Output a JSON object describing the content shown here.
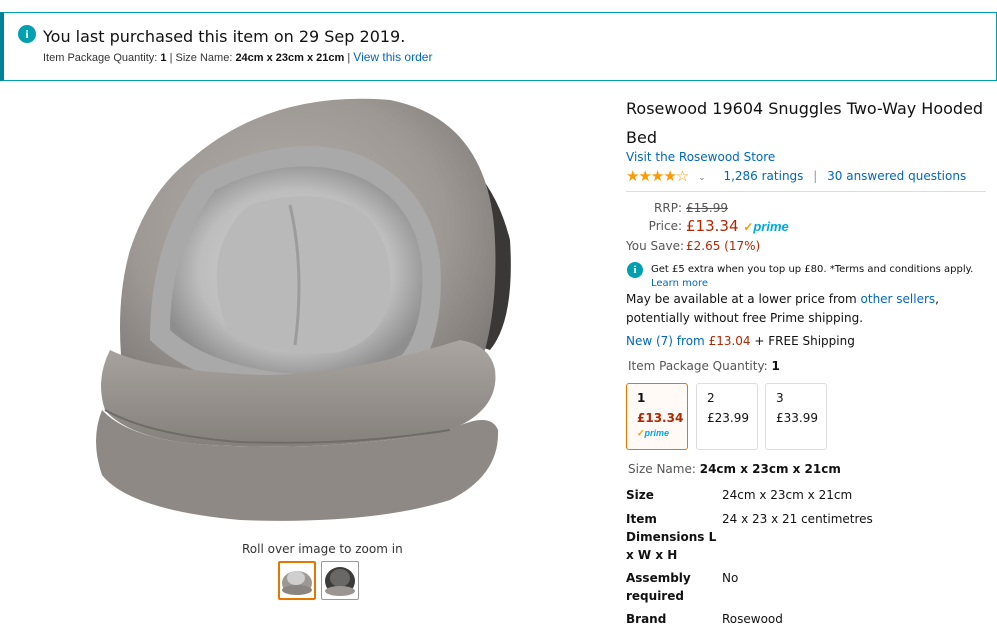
{
  "banner": {
    "info_icon": "info-icon",
    "title": "You last purchased this item on 29 Sep 2019.",
    "qty_label": "Item Package Quantity:",
    "qty_value": "1",
    "size_label": "Size Name:",
    "size_value": "24cm x 23cm x 21cm",
    "view_order": "View this order"
  },
  "gallery": {
    "zoom_hint": "Roll over image to zoom in",
    "thumbnails": [
      "thumbnail-front",
      "thumbnail-back"
    ]
  },
  "product": {
    "title": "Rosewood 19604 Snuggles Two-Way Hooded Bed",
    "store_link": "Visit the Rosewood Store",
    "stars": "★★★★☆",
    "rating_value": 4.0,
    "ratings_count": "1,286 ratings",
    "answered_questions": "30 answered questions",
    "rrp_label": "RRP:",
    "rrp_value": "£15.99",
    "price_label": "Price:",
    "price_value": "£13.34",
    "prime_check": "✓",
    "prime_label": "prime",
    "save_label": "You Save:",
    "save_value": "£2.65 (17%)",
    "topup_text": "Get £5 extra when you top up £80. *Terms and conditions apply.",
    "topup_link": "Learn more",
    "lower_price_text_1": "May be available at a lower price from",
    "lower_price_link": "other sellers",
    "lower_price_text_2": ", potentially without free Prime shipping.",
    "new_link": "New (7) from",
    "new_price": "£13.04",
    "new_shipping": "+ FREE Shipping",
    "qty_label": "Item Package Quantity:",
    "qty_selected": "1",
    "qty_options": [
      {
        "num": "1",
        "price": "£13.34",
        "prime": "prime"
      },
      {
        "num": "2",
        "price": "£23.99"
      },
      {
        "num": "3",
        "price": "£33.99"
      }
    ],
    "size_label": "Size Name:",
    "size_value": "24cm x 23cm x 21cm"
  },
  "specs": [
    {
      "key": "Size",
      "value": "24cm x 23cm x 21cm"
    },
    {
      "key": "Item Dimensions L x W x H",
      "value": "24 x 23 x 21 centimetres"
    },
    {
      "key": "Assembly required",
      "value": "No"
    },
    {
      "key": "Brand",
      "value": "Rosewood"
    }
  ],
  "colors": {
    "link": "#0066c0",
    "price": "#b12704",
    "star": "#ff9900",
    "selected_border": "#e77600",
    "teal": "#00a0b0"
  }
}
